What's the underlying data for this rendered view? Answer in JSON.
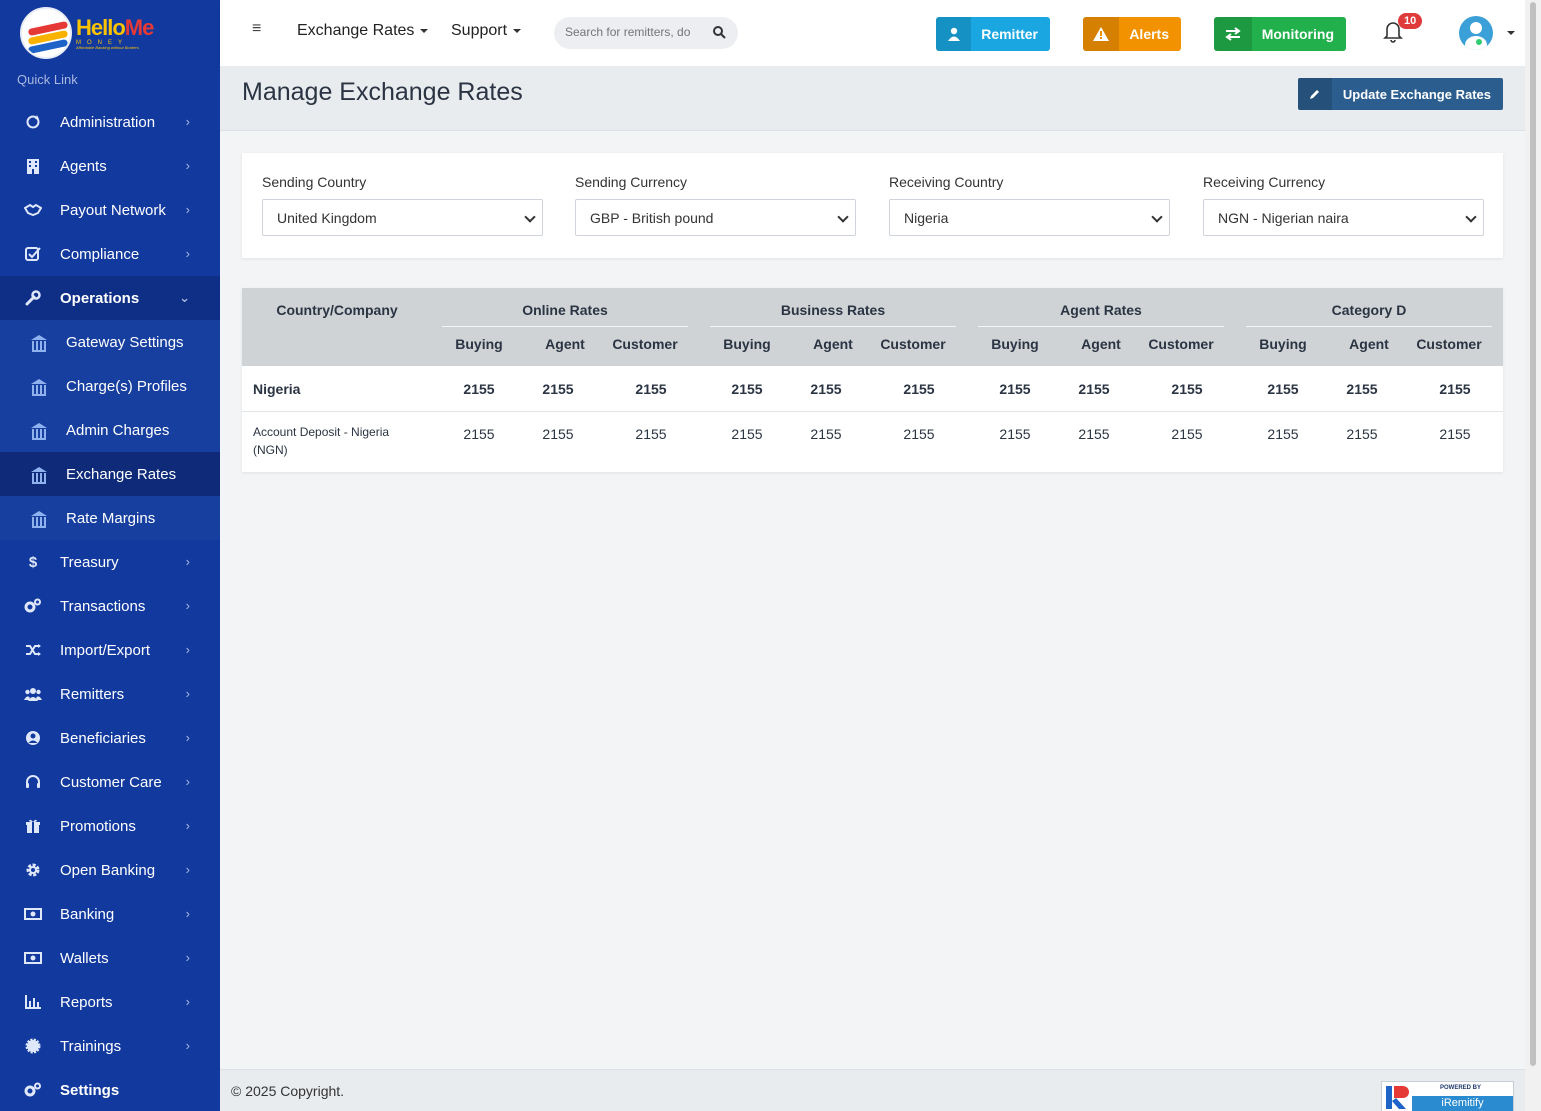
{
  "brand": {
    "logo_main_a": "Hello",
    "logo_main_b": "Me",
    "logo_sub": "MONEY",
    "logo_tag": "Affordable Banking without Borders"
  },
  "sidebar": {
    "quick_link": "Quick Link",
    "items": [
      {
        "label": "Administration",
        "icon": "refresh-icon"
      },
      {
        "label": "Agents",
        "icon": "building-icon"
      },
      {
        "label": "Payout Network",
        "icon": "handshake-icon"
      },
      {
        "label": "Compliance",
        "icon": "check-square-icon"
      },
      {
        "label": "Operations",
        "icon": "wrench-icon"
      },
      {
        "label": "Treasury",
        "icon": "dollar-icon"
      },
      {
        "label": "Transactions",
        "icon": "cogs-icon"
      },
      {
        "label": "Import/Export",
        "icon": "shuffle-icon"
      },
      {
        "label": "Remitters",
        "icon": "users-icon"
      },
      {
        "label": "Beneficiaries",
        "icon": "user-circle-icon"
      },
      {
        "label": "Customer Care",
        "icon": "headset-icon"
      },
      {
        "label": "Promotions",
        "icon": "gift-icon"
      },
      {
        "label": "Open Banking",
        "icon": "gear-icon"
      },
      {
        "label": "Banking",
        "icon": "money-icon"
      },
      {
        "label": "Wallets",
        "icon": "money-icon"
      },
      {
        "label": "Reports",
        "icon": "bar-chart-icon"
      },
      {
        "label": "Trainings",
        "icon": "badge-icon"
      },
      {
        "label": "Settings",
        "icon": "cogs-icon"
      }
    ],
    "operations_sub": [
      {
        "label": "Gateway Settings"
      },
      {
        "label": "Charge(s) Profiles"
      },
      {
        "label": "Admin Charges"
      },
      {
        "label": "Exchange Rates"
      },
      {
        "label": "Rate Margins"
      }
    ]
  },
  "topbar": {
    "menu_exchange": "Exchange Rates",
    "menu_support": "Support",
    "search_placeholder": "Search for remitters, do",
    "btn_remitter": "Remitter",
    "btn_alerts": "Alerts",
    "btn_monitoring": "Monitoring",
    "notifications_count": "10",
    "colors": {
      "remitter": "#1aa6e0",
      "alerts": "#f39200",
      "monitoring": "#21b04b"
    }
  },
  "page": {
    "title": "Manage Exchange Rates",
    "update_button": "Update Exchange Rates"
  },
  "filters": {
    "sending_country": {
      "label": "Sending Country",
      "value": "United Kingdom"
    },
    "sending_currency": {
      "label": "Sending Currency",
      "value": "GBP - British pound"
    },
    "receiving_country": {
      "label": "Receiving Country",
      "value": "Nigeria"
    },
    "receiving_currency": {
      "label": "Receiving Currency",
      "value": "NGN - Nigerian naira"
    }
  },
  "table": {
    "first_col": "Country/Company",
    "groups": [
      "Online Rates",
      "Business Rates",
      "Agent Rates",
      "Category D"
    ],
    "subcols": [
      "Buying",
      "Agent",
      "Customer"
    ],
    "rows": [
      {
        "label": "Nigeria",
        "values": [
          "2155",
          "2155",
          "2155",
          "2155",
          "2155",
          "2155",
          "2155",
          "2155",
          "2155",
          "2155",
          "2155",
          "2155"
        ]
      },
      {
        "label": "Account Deposit - Nigeria (NGN)",
        "values": [
          "2155",
          "2155",
          "2155",
          "2155",
          "2155",
          "2155",
          "2155",
          "2155",
          "2155",
          "2155",
          "2155",
          "2155"
        ]
      }
    ]
  },
  "footer": {
    "copyright": "© 2025 Copyright.",
    "powered_by": "POWERED BY",
    "powered_name": "iRemitify"
  }
}
